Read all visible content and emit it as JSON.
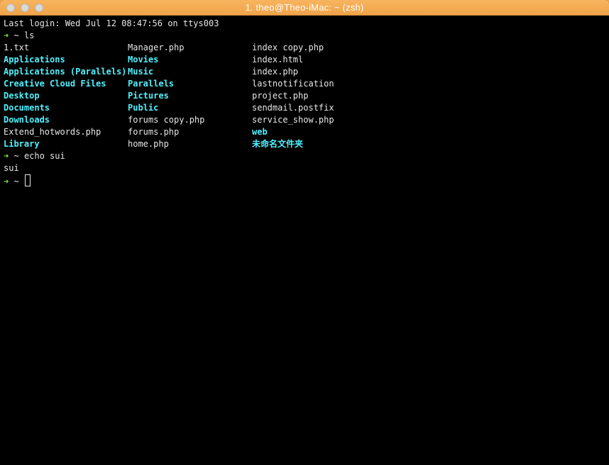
{
  "window": {
    "title": "1. theo@Theo-iMac: ~ (zsh)"
  },
  "terminal": {
    "last_login": "Last login: Wed Jul 12 08:47:56 on ttys003",
    "prompt_arrow": "➜",
    "prompt_dir": "~",
    "cmd1": "ls",
    "cmd2": "echo sui",
    "output2": "sui",
    "ls_rows": [
      [
        {
          "name": "1.txt",
          "type": "file"
        },
        {
          "name": "Manager.php",
          "type": "file"
        },
        {
          "name": "index copy.php",
          "type": "file"
        }
      ],
      [
        {
          "name": "Applications",
          "type": "dir"
        },
        {
          "name": "Movies",
          "type": "dir"
        },
        {
          "name": "index.html",
          "type": "file"
        }
      ],
      [
        {
          "name": "Applications (Parallels)",
          "type": "dir"
        },
        {
          "name": "Music",
          "type": "dir"
        },
        {
          "name": "index.php",
          "type": "file"
        }
      ],
      [
        {
          "name": "Creative Cloud Files",
          "type": "dir"
        },
        {
          "name": "Parallels",
          "type": "dir"
        },
        {
          "name": "lastnotification",
          "type": "file"
        }
      ],
      [
        {
          "name": "Desktop",
          "type": "dir"
        },
        {
          "name": "Pictures",
          "type": "dir"
        },
        {
          "name": "project.php",
          "type": "file"
        }
      ],
      [
        {
          "name": "Documents",
          "type": "dir"
        },
        {
          "name": "Public",
          "type": "dir"
        },
        {
          "name": "sendmail.postfix",
          "type": "file"
        }
      ],
      [
        {
          "name": "Downloads",
          "type": "dir"
        },
        {
          "name": "forums copy.php",
          "type": "file"
        },
        {
          "name": "service_show.php",
          "type": "file"
        }
      ],
      [
        {
          "name": "Extend_hotwords.php",
          "type": "file"
        },
        {
          "name": "forums.php",
          "type": "file"
        },
        {
          "name": "web",
          "type": "dir"
        }
      ],
      [
        {
          "name": "Library",
          "type": "dir"
        },
        {
          "name": "home.php",
          "type": "file"
        },
        {
          "name": "未命名文件夹",
          "type": "dir"
        }
      ]
    ]
  },
  "colors": {
    "titlebar": "#f0a44a",
    "prompt_arrow": "#7fe34a",
    "directory": "#4ff2ff",
    "text": "#e6e6e6",
    "background": "#000000"
  }
}
